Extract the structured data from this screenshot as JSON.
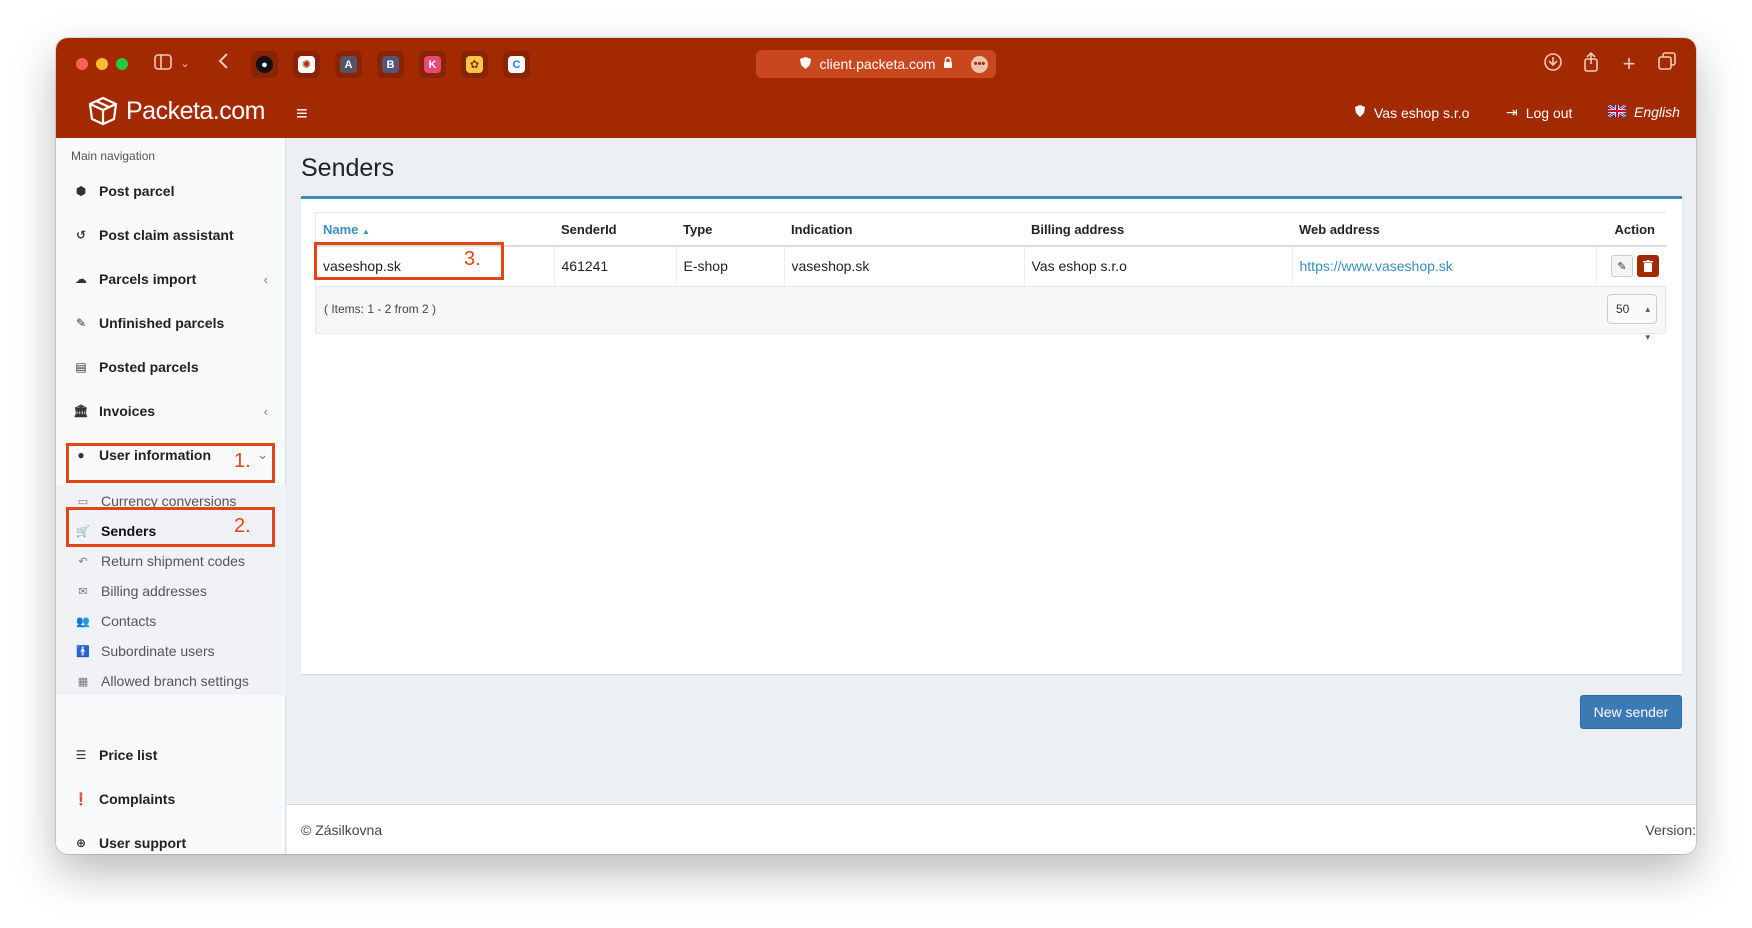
{
  "browser": {
    "url": "client.packeta.com",
    "favicons": [
      "github",
      "chatgpt",
      "A",
      "B",
      "K",
      "app",
      "C"
    ]
  },
  "header": {
    "logo_text": "Packeta.com",
    "account": "Vas eshop s.r.o",
    "logout": "Log out",
    "language": "English"
  },
  "sidebar": {
    "caption": "Main navigation",
    "items": [
      {
        "label": "Post parcel",
        "icon": "box-icon"
      },
      {
        "label": "Post claim assistant",
        "icon": "undo-icon"
      },
      {
        "label": "Parcels import",
        "icon": "cloud-upload-icon"
      },
      {
        "label": "Unfinished parcels",
        "icon": "edit-icon"
      },
      {
        "label": "Posted parcels",
        "icon": "archive-icon"
      },
      {
        "label": "Invoices",
        "icon": "bank-icon"
      },
      {
        "label": "User information",
        "icon": "user-icon"
      },
      {
        "label": "Price list",
        "icon": "list-icon"
      },
      {
        "label": "Complaints",
        "icon": "exclamation-icon"
      },
      {
        "label": "User support",
        "icon": "lifebuoy-icon"
      }
    ],
    "subitems": [
      {
        "label": "Currency conversions",
        "icon": "money-icon"
      },
      {
        "label": "Senders",
        "icon": "cart-icon"
      },
      {
        "label": "Return shipment codes",
        "icon": "reply-icon"
      },
      {
        "label": "Billing addresses",
        "icon": "envelope-icon"
      },
      {
        "label": "Contacts",
        "icon": "users-icon"
      },
      {
        "label": "Subordinate users",
        "icon": "person-icon"
      },
      {
        "label": "Allowed branch settings",
        "icon": "grid-icon"
      }
    ]
  },
  "callouts": [
    "1.",
    "2.",
    "3."
  ],
  "main": {
    "title": "Senders",
    "columns": [
      "Name",
      "SenderId",
      "Type",
      "Indication",
      "Billing address",
      "Web address",
      "Action"
    ],
    "rows": [
      [
        "vaseshop.sk",
        "461241",
        "E-shop",
        "vaseshop.sk",
        "Vas eshop s.r.o",
        "https://www.vaseshop.sk"
      ]
    ],
    "items_info": "( Items: 1 - 2 from 2 )",
    "page_size": "50",
    "new_sender_label": "New sender"
  },
  "footer": {
    "copyright": "© Zásilkovna",
    "version": "Version:"
  },
  "colors": {
    "brand": "#a32a00",
    "link": "#3c8dbc",
    "callout": "#e04616"
  }
}
